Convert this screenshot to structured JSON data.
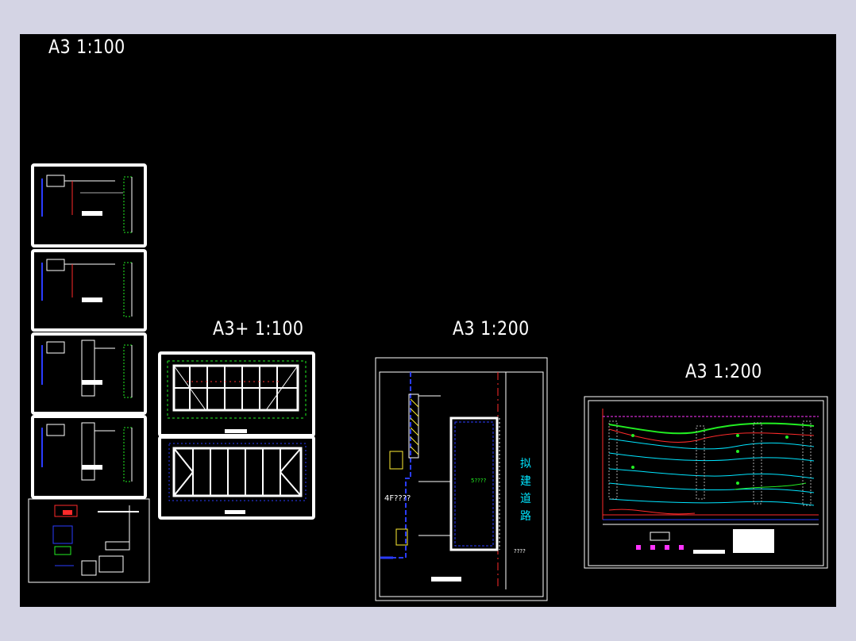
{
  "canvas": {
    "background": "#000000",
    "window_background": "#d4d4e4"
  },
  "labels": {
    "group1": "A3 1:100",
    "group2": "A3+ 1:100",
    "group3": "A3 1:200",
    "group4": "A3 1:200"
  },
  "drawings": {
    "site_plan": {
      "floor_label": "4F????",
      "building_label": "5????",
      "road_label": "拟建道路",
      "road_chars": [
        "拟",
        "建",
        "道",
        "路"
      ],
      "question_marks": "????"
    }
  },
  "colors": {
    "line_white": "#ffffff",
    "line_blue": "#2a3cff",
    "line_cyan": "#00e5ff",
    "line_green": "#22ee22",
    "line_red": "#ff2a2a",
    "line_magenta": "#ff33ff",
    "line_yellow": "#ffee33"
  }
}
